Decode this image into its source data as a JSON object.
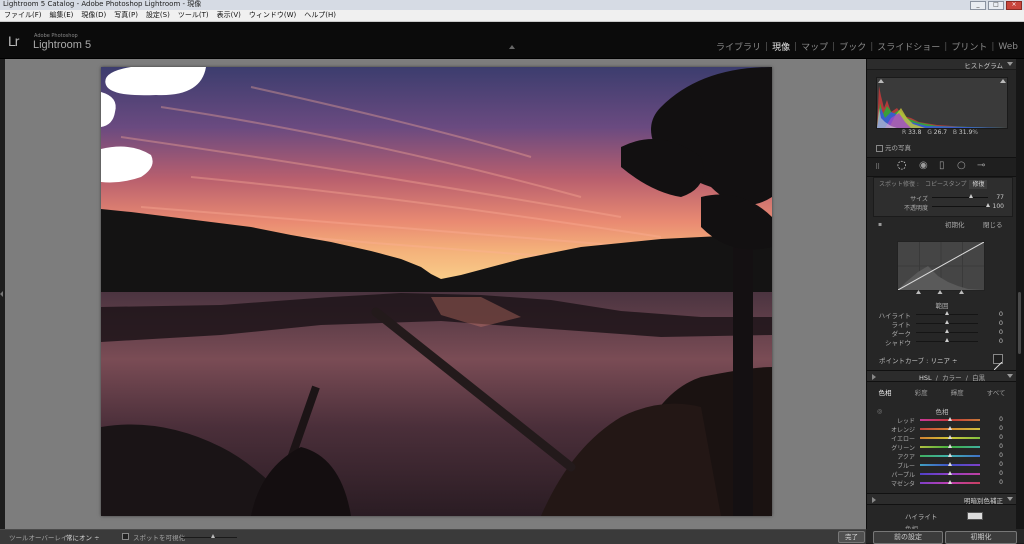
{
  "window": {
    "title": "Lightroom 5 Catalog - Adobe Photoshop Lightroom - 現像"
  },
  "menu": [
    "ファイル(F)",
    "編集(E)",
    "現像(D)",
    "写真(P)",
    "設定(S)",
    "ツール(T)",
    "表示(V)",
    "ウィンドウ(W)",
    "ヘルプ(H)"
  ],
  "app": {
    "logo_mark": "Lr",
    "logo_sub": "Adobe Photoshop",
    "logo_name": "Lightroom 5"
  },
  "modules": [
    "ライブラリ",
    "現像",
    "マップ",
    "ブック",
    "スライドショー",
    "プリント",
    "Web"
  ],
  "histogram": {
    "title": "ヒストグラム",
    "r_label": "R",
    "r_value": "33.8",
    "g_label": "G",
    "g_value": "26.7",
    "b_label": "B",
    "b_value": "31.9",
    "unit": "%",
    "original_photo": "元の写真"
  },
  "spot_removal": {
    "tabs": [
      "スポット修復 :",
      "コピースタンプ",
      "修復"
    ],
    "size_label": "サイズ",
    "size_value": "77",
    "size_level": 0.7,
    "opacity_label": "不透明度",
    "opacity_value": "100",
    "opacity_level": 1.0,
    "reset": "初期化",
    "close": "閉じる"
  },
  "tone_curve": {
    "region_title": "範囲",
    "rows": [
      {
        "label": "ハイライト",
        "value": "0"
      },
      {
        "label": "ライト",
        "value": "0"
      },
      {
        "label": "ダーク",
        "value": "0"
      },
      {
        "label": "シャドウ",
        "value": "0"
      }
    ],
    "point_curve_label": "ポイントカーブ :",
    "point_curve_value": "リニア ÷"
  },
  "hsl": {
    "header_hsl": "HSL",
    "header_color": "カラー",
    "header_bw": "白黒",
    "tabs": [
      "色相",
      "彩度",
      "輝度",
      "すべて"
    ],
    "sub_title": "色相",
    "rows": [
      {
        "label": "レッド",
        "value": "0",
        "grad": "linear-gradient(90deg,#c8389a,#c83838,#c87a38)"
      },
      {
        "label": "オレンジ",
        "value": "0",
        "grad": "linear-gradient(90deg,#c84040,#d88a30,#d0c040)"
      },
      {
        "label": "イエロー",
        "value": "0",
        "grad": "linear-gradient(90deg,#d08030,#d0c838,#80c040)"
      },
      {
        "label": "グリーン",
        "value": "0",
        "grad": "linear-gradient(90deg,#b0c040,#40b040,#40b0a0)"
      },
      {
        "label": "アクア",
        "value": "0",
        "grad": "linear-gradient(90deg,#40b060,#40b0b0,#4070c8)"
      },
      {
        "label": "ブルー",
        "value": "0",
        "grad": "linear-gradient(90deg,#40a0c0,#4050c8,#8040c8)"
      },
      {
        "label": "パープル",
        "value": "0",
        "grad": "linear-gradient(90deg,#5040c8,#9040c8,#c040a0)"
      },
      {
        "label": "マゼンタ",
        "value": "0",
        "grad": "linear-gradient(90deg,#8040c8,#c040b0,#c84060)"
      }
    ]
  },
  "split_toning": {
    "title": "明暗別色補正",
    "highlight_label": "ハイライト",
    "hue_label": "色相"
  },
  "toolbar": {
    "overlay_label": "ツールオーバーレイ :",
    "overlay_value": "常にオン ÷",
    "visualize_spots": "スポットを可視化",
    "done": "完了"
  },
  "bottom_buttons": {
    "previous": "前の設定",
    "reset": "初期化"
  }
}
